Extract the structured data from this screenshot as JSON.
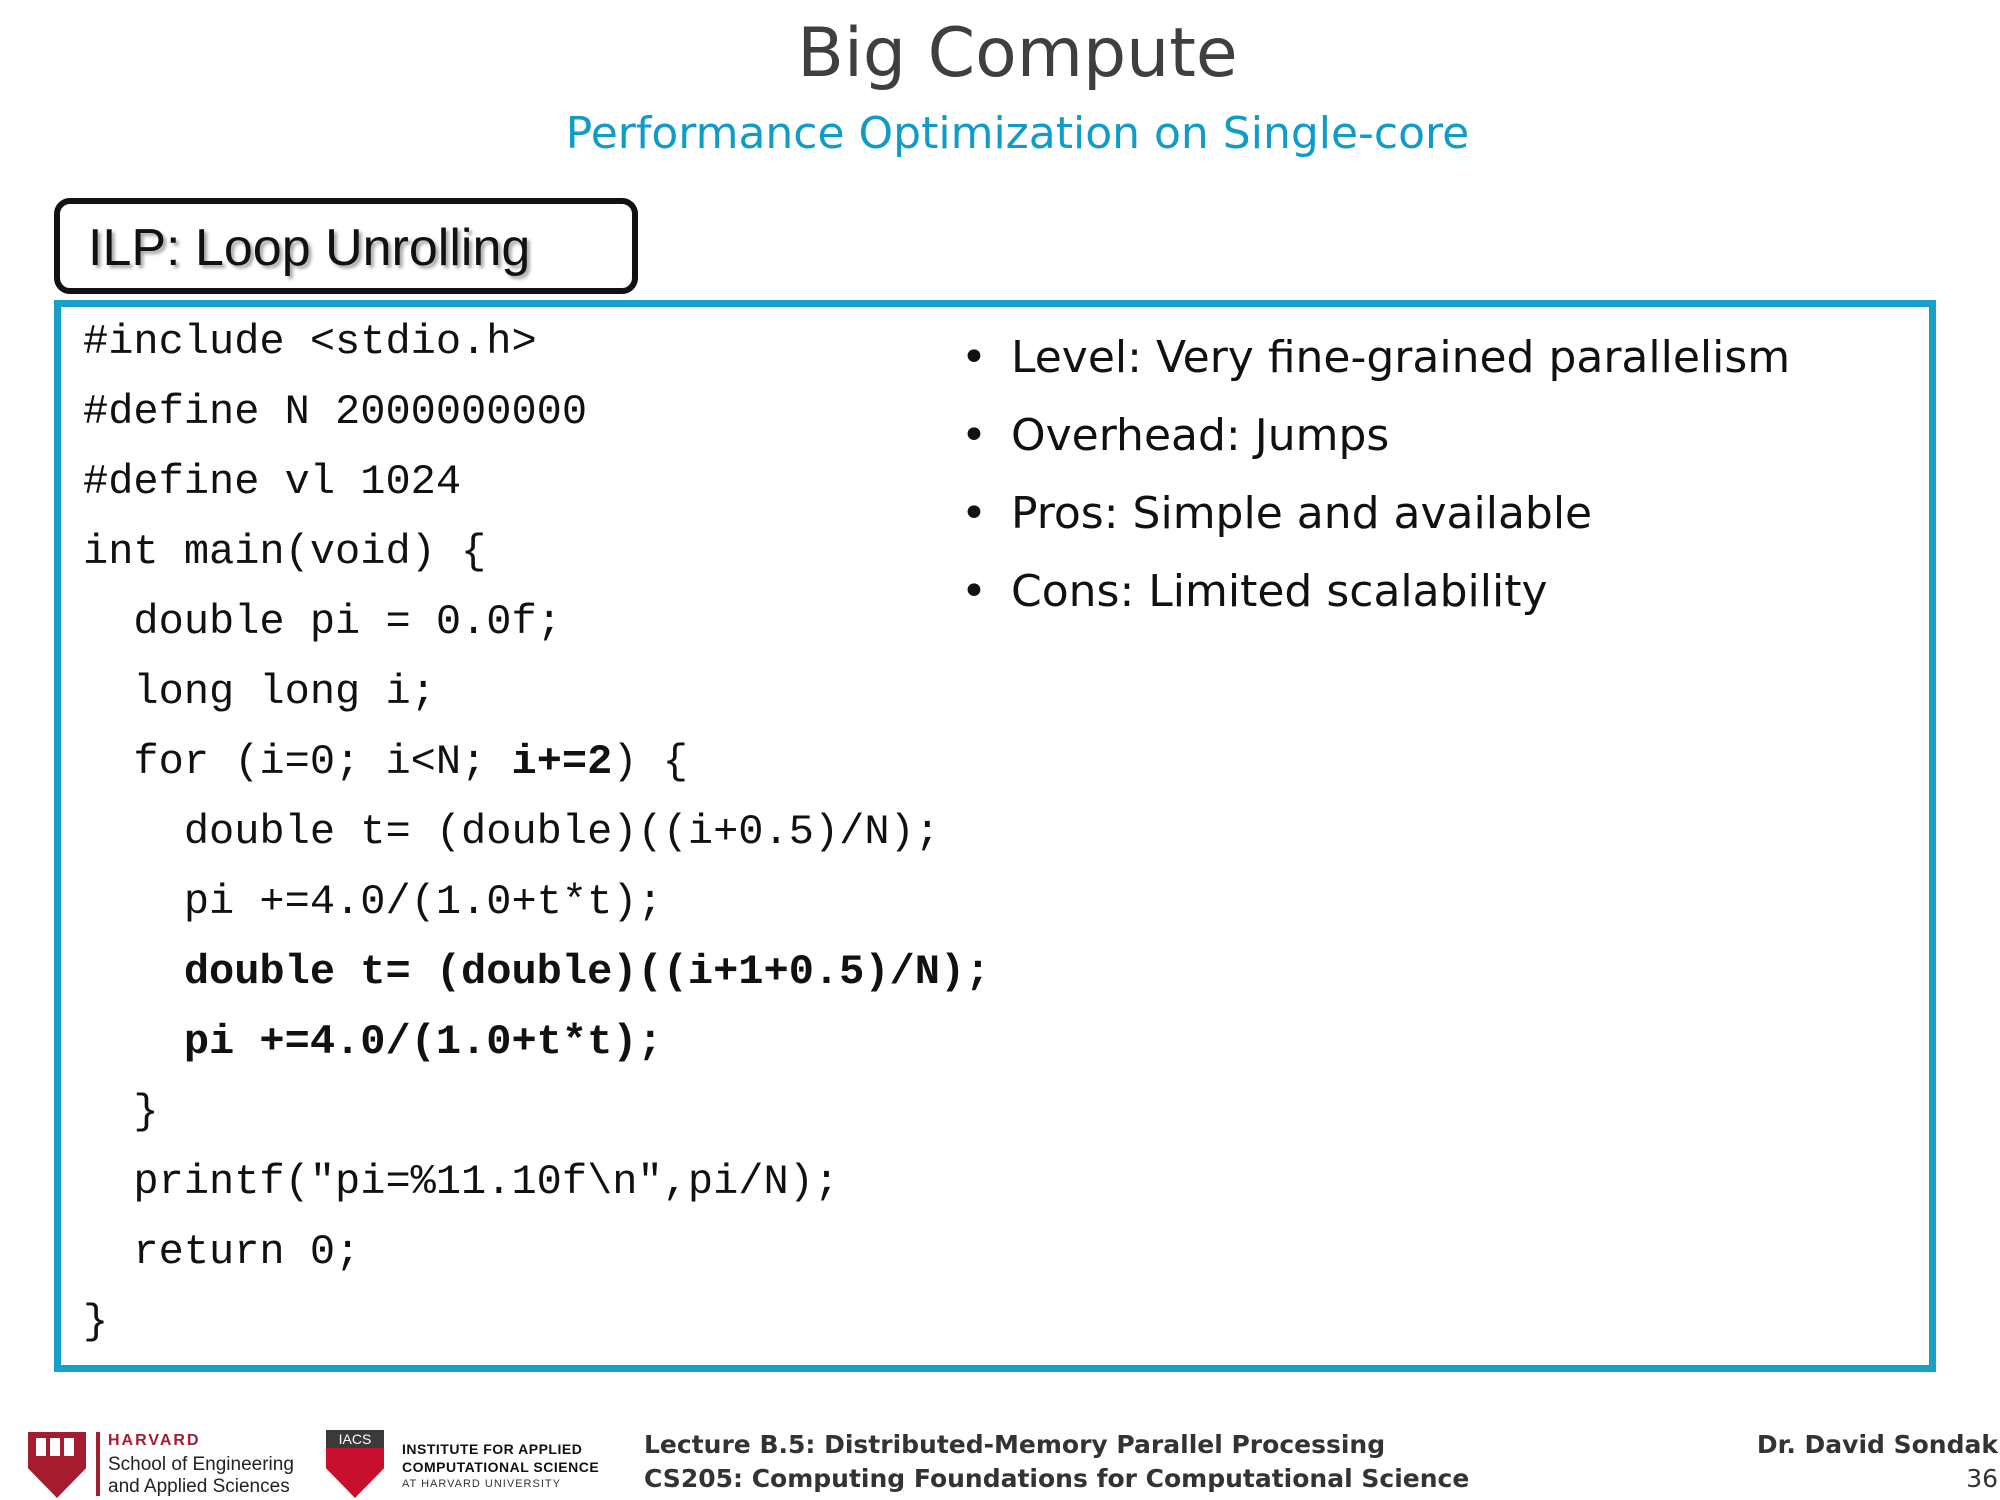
{
  "slide": {
    "title": "Big Compute",
    "subtitle": "Performance Optimization on Single-core",
    "section_label": "ILP: Loop Unrolling"
  },
  "code_lines": [
    {
      "text": "#include <stdio.h>",
      "bold": false
    },
    {
      "text": "#define N 2000000000",
      "bold": false
    },
    {
      "text": "#define vl 1024",
      "bold": false
    },
    {
      "text": "int main(void) {",
      "bold": false
    },
    {
      "text": "  double pi = 0.0f;",
      "bold": false
    },
    {
      "text": "  long long i;",
      "bold": false
    },
    {
      "text": "  for (i=0; i<N; ",
      "bold_tail": "i+=2",
      "tail": ") {"
    },
    {
      "text": "    double t= (double)((i+0.5)/N);",
      "bold": false
    },
    {
      "text": "    pi +=4.0/(1.0+t*t);",
      "bold": false
    },
    {
      "text": "    double t= (double)((i+1+0.5)/N);",
      "bold": true
    },
    {
      "text": "    pi +=4.0/(1.0+t*t);",
      "bold": true
    },
    {
      "text": "  }",
      "bold": false
    },
    {
      "text": "  printf(\"pi=%11.10f\\n\",pi/N);",
      "bold": false
    },
    {
      "text": "  return 0;",
      "bold": false
    },
    {
      "text": "}",
      "bold": false
    }
  ],
  "bullets": [
    "Level: Very fine-grained parallelism",
    "Overhead: Jumps",
    "Pros: Simple and available",
    "Cons: Limited scalability"
  ],
  "footer": {
    "harvard_word": "HARVARD",
    "seas_line1": "School of Engineering",
    "seas_line2": "and Applied Sciences",
    "iacs_tag": "IACS",
    "iacs_line1": "INSTITUTE FOR APPLIED",
    "iacs_line2": "COMPUTATIONAL SCIENCE",
    "iacs_line3": "AT HARVARD UNIVERSITY",
    "lecture_line1": "Lecture B.5: Distributed-Memory Parallel Processing",
    "lecture_line2": "CS205: Computing Foundations for Computational Science",
    "author": "Dr. David Sondak",
    "page_number": "36"
  },
  "colors": {
    "accent": "#0f9cc6",
    "box_border": "#14a0c8",
    "harvard_crimson": "#a51c30"
  }
}
